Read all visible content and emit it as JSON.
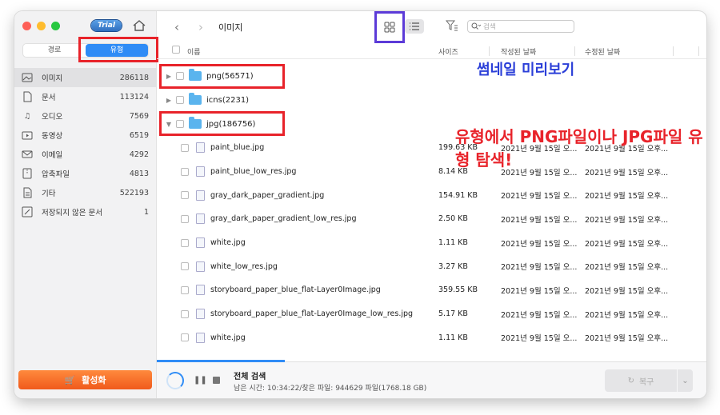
{
  "sidebar": {
    "trial_badge": "Trial",
    "segments": [
      {
        "label": "경로",
        "active": false
      },
      {
        "label": "유형",
        "active": true
      }
    ],
    "items": [
      {
        "label": "이미지",
        "count": "286118",
        "icon": "image-icon",
        "selected": true
      },
      {
        "label": "문서",
        "count": "113124",
        "icon": "document-icon",
        "selected": false
      },
      {
        "label": "오디오",
        "count": "7569",
        "icon": "music-icon",
        "selected": false
      },
      {
        "label": "동영상",
        "count": "6519",
        "icon": "video-icon",
        "selected": false
      },
      {
        "label": "이메일",
        "count": "4292",
        "icon": "mail-icon",
        "selected": false
      },
      {
        "label": "압축파일",
        "count": "4813",
        "icon": "archive-icon",
        "selected": false
      },
      {
        "label": "기타",
        "count": "522193",
        "icon": "other-icon",
        "selected": false
      },
      {
        "label": "저장되지 않은 문서",
        "count": "1",
        "icon": "unsaved-doc-icon",
        "selected": false
      }
    ],
    "activate_label": "활성화"
  },
  "toolbar": {
    "title": "이미지",
    "search_placeholder": "검색"
  },
  "columns": {
    "name": "이름",
    "size": "사이즈",
    "created": "작성된 날짜",
    "modified": "수정된 날짜"
  },
  "folders": [
    {
      "label": "png(56571)",
      "expanded": false
    },
    {
      "label": "icns(2231)",
      "expanded": false
    },
    {
      "label": "jpg(186756)",
      "expanded": true
    }
  ],
  "files": [
    {
      "name": "paint_blue.jpg",
      "size": "199.63 KB",
      "created": "2021년 9월 15일 오...",
      "modified": "2021년 9월 15일 오후..."
    },
    {
      "name": "paint_blue_low_res.jpg",
      "size": "8.14 KB",
      "created": "2021년 9월 15일 오...",
      "modified": "2021년 9월 15일 오후..."
    },
    {
      "name": "gray_dark_paper_gradient.jpg",
      "size": "154.91 KB",
      "created": "2021년 9월 15일 오...",
      "modified": "2021년 9월 15일 오후..."
    },
    {
      "name": "gray_dark_paper_gradient_low_res.jpg",
      "size": "2.50 KB",
      "created": "2021년 9월 15일 오...",
      "modified": "2021년 9월 15일 오후..."
    },
    {
      "name": "white.jpg",
      "size": "1.11 KB",
      "created": "2021년 9월 15일 오...",
      "modified": "2021년 9월 15일 오후..."
    },
    {
      "name": "white_low_res.jpg",
      "size": "3.27 KB",
      "created": "2021년 9월 15일 오...",
      "modified": "2021년 9월 15일 오후..."
    },
    {
      "name": "storyboard_paper_blue_flat-Layer0Image.jpg",
      "size": "359.55 KB",
      "created": "2021년 9월 15일 오...",
      "modified": "2021년 9월 15일 오후..."
    },
    {
      "name": "storyboard_paper_blue_flat-Layer0Image_low_res.jpg",
      "size": "5.17 KB",
      "created": "2021년 9월 15일 오...",
      "modified": "2021년 9월 15일 오후..."
    },
    {
      "name": "white.jpg",
      "size": "1.11 KB",
      "created": "2021년 9월 15일 오...",
      "modified": "2021년 9월 15일 오후..."
    }
  ],
  "annotations": {
    "thumbnail": "썸네일 미리보기",
    "type_search": "유형에서 PNG파일이나 JPG파일 유형 탐색!"
  },
  "status": {
    "title": "전체 검색",
    "subtitle": "남은 시간: 10:34:22/찾은 파일: 944629 파일(1768.18 GB)",
    "restore_label": "복구"
  },
  "colors": {
    "accent": "#2f8cf6",
    "highlight_red": "#e8232a",
    "highlight_blue": "#5c3bd8",
    "activate_orange": "#f05a1c"
  }
}
